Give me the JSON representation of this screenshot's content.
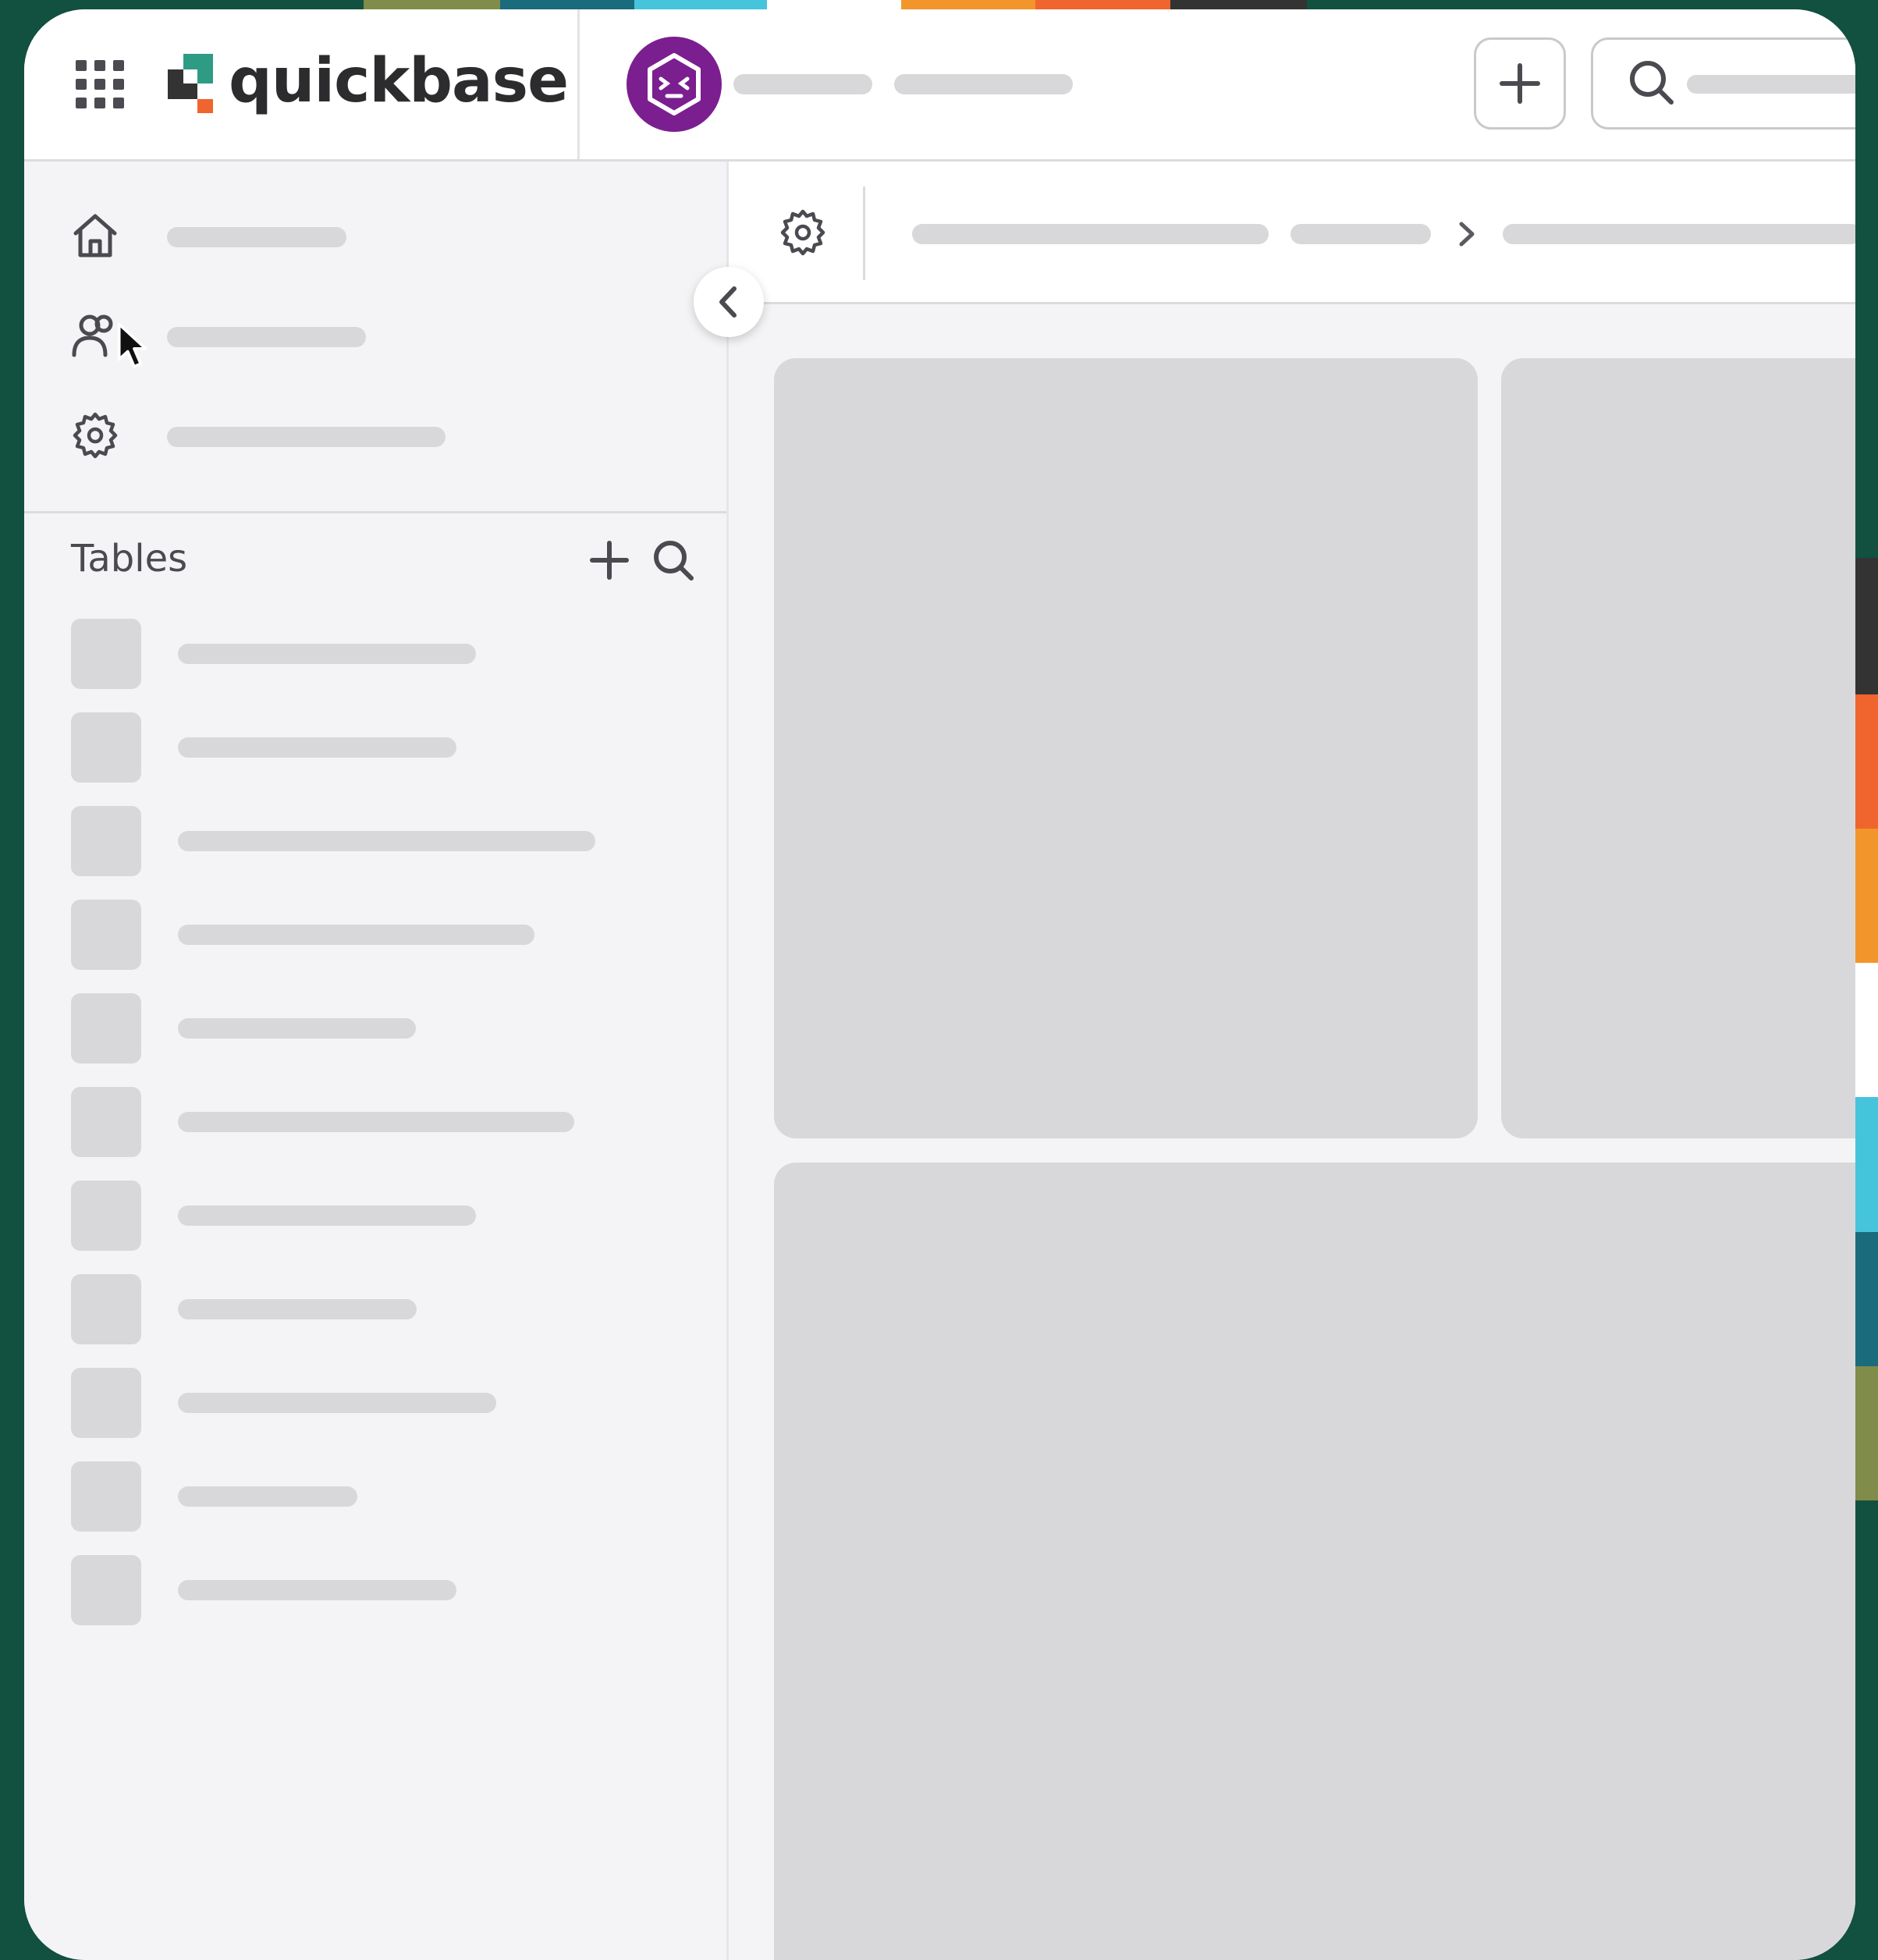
{
  "brand": {
    "name": "quickbase",
    "logo_colors": [
      "#2e9b84",
      "#333333",
      "#f0642e"
    ],
    "background": "#12503f"
  },
  "colors": {
    "app_avatar": "#7b1e8f",
    "skeleton": "#d8d8db",
    "sidebar_bg": "#f4f4f6",
    "icon": "#4a4a50"
  },
  "header": {
    "grid_icon": "apps-grid-icon",
    "app_icon": "cube-app-icon",
    "add_icon": "plus-icon",
    "search_icon": "search-icon"
  },
  "sidebar": {
    "nav_icons": [
      "home-icon",
      "users-icon",
      "gear-icon"
    ],
    "tables_label": "Tables",
    "tables_actions": [
      "plus-icon",
      "search-icon"
    ],
    "table_count": 11
  },
  "main": {
    "settings_icon": "gear-icon",
    "breadcrumb_separator": "chevron-right-icon",
    "collapse_icon": "chevron-left-icon"
  }
}
